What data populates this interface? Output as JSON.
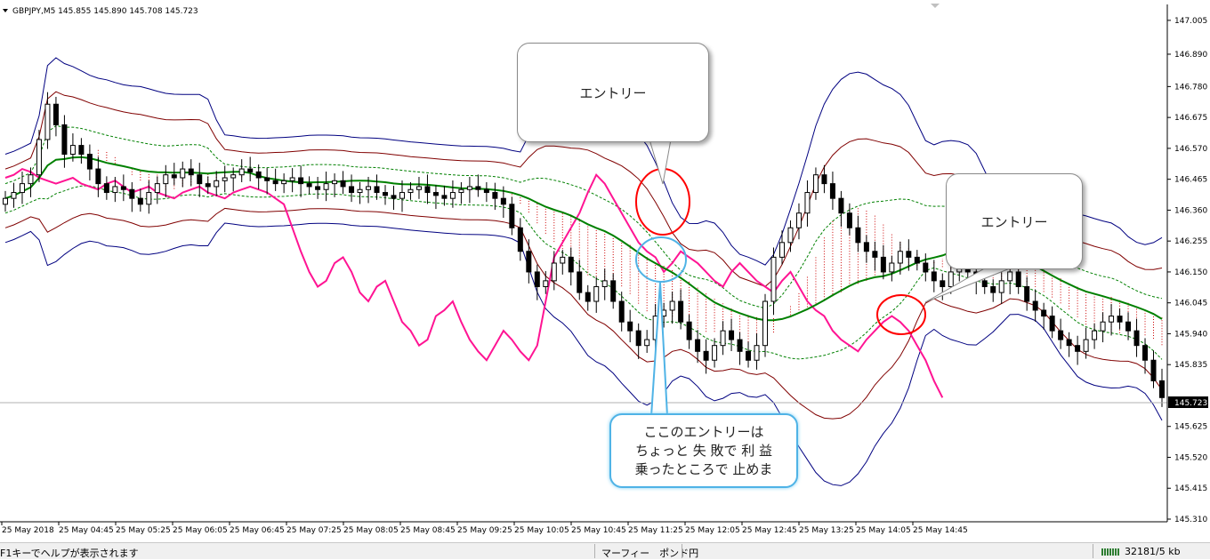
{
  "header": {
    "symbol_info": "GBPJPY,M5  145.855 145.890 145.708 145.723"
  },
  "price_axis": {
    "labels": [
      "147.005",
      "146.890",
      "146.780",
      "146.675",
      "146.570",
      "146.465",
      "146.360",
      "146.255",
      "146.150",
      "146.045",
      "145.940",
      "145.835",
      "145.723",
      "145.625",
      "145.520",
      "145.415",
      "145.310"
    ],
    "current_price": "145.723"
  },
  "time_axis": {
    "labels": [
      "25 May 2018",
      "25 May 04:45",
      "25 May 05:25",
      "25 May 06:05",
      "25 May 06:45",
      "25 May 07:25",
      "25 May 08:05",
      "25 May 08:45",
      "25 May 09:25",
      "25 May 10:05",
      "25 May 10:45",
      "25 May 11:25",
      "25 May 12:05",
      "25 May 12:45",
      "25 May 13:25",
      "25 May 14:05",
      "25 May 14:45"
    ]
  },
  "annotations": {
    "callout_1": "エントリー",
    "callout_2": "エントリー",
    "callout_3": [
      "ここのエントリーは",
      "ちょっと 失 敗で 利 益",
      "乗ったところで 止めま"
    ]
  },
  "status_bar": {
    "help_text": "F1キーでヘルプが表示されます",
    "profile": "マーフィー　ポンド円",
    "traffic": "32181/5 kb"
  },
  "colors": {
    "bullish": "#ffffff",
    "bearish": "#000000",
    "ma_green": "#008000",
    "pink_line": "#ff1493",
    "bands_navy": "#000080",
    "bands_dark": "#800000",
    "cloud": "#cc0000",
    "highlight_red": "#ff0000",
    "highlight_blue": "#4fb3e6"
  },
  "chart_data": {
    "type": "candlestick",
    "symbol": "GBPJPY",
    "timeframe": "M5",
    "ylim": [
      145.31,
      147.05
    ],
    "x_start": "2018-05-25 04:05",
    "x_end": "2018-05-25 14:50",
    "interval_minutes": 5,
    "close_series": [
      146.4,
      146.42,
      146.45,
      146.48,
      146.6,
      146.72,
      146.65,
      146.55,
      146.58,
      146.55,
      146.5,
      146.45,
      146.42,
      146.44,
      146.43,
      146.4,
      146.38,
      146.42,
      146.45,
      146.48,
      146.47,
      146.5,
      146.48,
      146.45,
      146.44,
      146.46,
      146.47,
      146.48,
      146.5,
      146.49,
      146.47,
      146.46,
      146.45,
      146.46,
      146.47,
      146.45,
      146.44,
      146.43,
      146.45,
      146.46,
      146.44,
      146.42,
      146.43,
      146.44,
      146.42,
      146.41,
      146.4,
      146.42,
      146.43,
      146.44,
      146.42,
      146.41,
      146.4,
      146.42,
      146.43,
      146.44,
      146.43,
      146.42,
      146.4,
      146.38,
      146.3,
      146.22,
      146.15,
      146.1,
      146.12,
      146.18,
      146.2,
      146.15,
      146.08,
      146.05,
      146.1,
      146.12,
      146.05,
      145.98,
      145.95,
      145.9,
      145.92,
      146.0,
      146.02,
      146.05,
      145.98,
      145.92,
      145.88,
      145.85,
      145.9,
      145.95,
      145.92,
      145.88,
      145.85,
      145.9,
      146.05,
      146.2,
      146.25,
      146.3,
      146.35,
      146.42,
      146.48,
      146.45,
      146.4,
      146.35,
      146.3,
      146.25,
      146.22,
      146.2,
      146.15,
      146.18,
      146.22,
      146.2,
      146.18,
      146.15,
      146.12,
      146.1,
      146.15,
      146.18,
      146.15,
      146.12,
      146.1,
      146.08,
      146.12,
      146.15,
      146.1,
      146.05,
      146.02,
      146.0,
      145.95,
      145.92,
      145.9,
      145.88,
      145.92,
      145.95,
      145.98,
      146.0,
      145.98,
      145.95,
      145.9,
      145.85,
      145.78,
      145.723
    ]
  }
}
